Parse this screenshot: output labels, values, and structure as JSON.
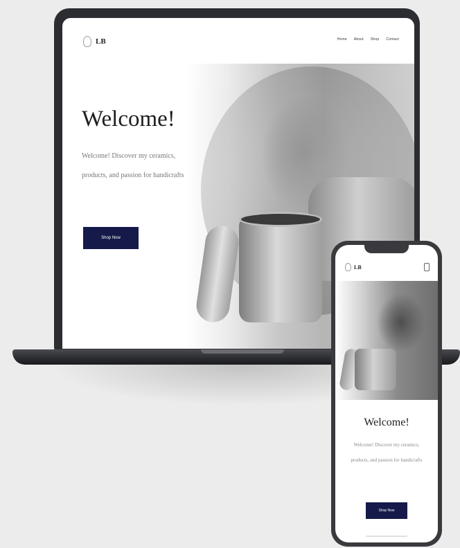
{
  "desktop": {
    "logo_text": "LB",
    "nav": [
      "Home",
      "About",
      "Shop",
      "Contact"
    ],
    "hero": {
      "title": "Welcome!",
      "text": "Welcome! Discover my ceramics, products, and passion for handicrafts",
      "button_label": "Shop Now"
    }
  },
  "mobile": {
    "logo_text": "LB",
    "hero": {
      "title": "Welcome!",
      "text": "Welcome! Discover my ceramics, products, and passion for handicrafts",
      "button_label": "Shop Now"
    }
  },
  "colors": {
    "background": "#ececec",
    "device_frame": "#2c2d31",
    "button": "#151a4a"
  }
}
